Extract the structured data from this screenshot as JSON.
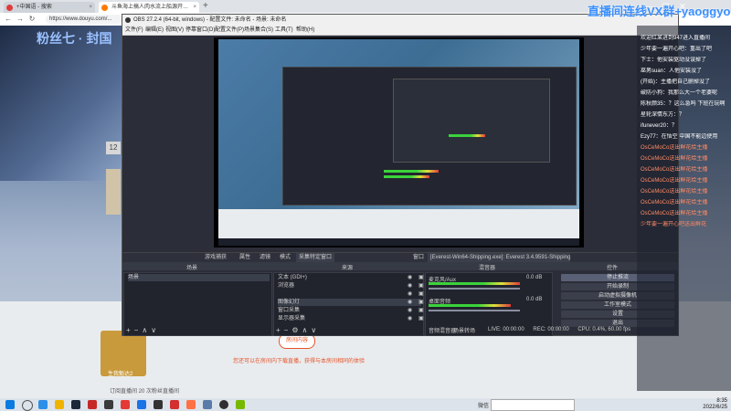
{
  "browser": {
    "tabs": [
      {
        "label": "+中国语 - 搜索"
      },
      {
        "label": "斗鱼海上搞人肉水流上船源开…"
      }
    ],
    "url": "https://www.douyu.com/..."
  },
  "stream": {
    "game_title": "粉丝七 · 封国",
    "room_button": "房间内容",
    "hint": "您还可以在房间内下载直播，获得与本房间相同的体验",
    "gift": "生我魁达2",
    "fav_text": "订阅直播间  20 次粉丝直播间"
  },
  "watermark": "直播间连线VX群+yaoggyo",
  "obs": {
    "title": "OBS 27.2.4 (64-bit, windows) - 配置文件: 未命名 - 场景: 未命名",
    "menu": [
      "文件(F)",
      "编辑(E)",
      "视图(V)",
      "停靠窗口(D)",
      "配置文件(P)",
      "场景集合(S)",
      "工具(T)",
      "帮助(H)"
    ],
    "toolbar": {
      "source_name": "游戏捕获",
      "properties": "属性",
      "filters": "滤镜",
      "mode_label": "模式",
      "mode_value": "采集特定窗口",
      "window_label": "窗口",
      "window_value": "[Everest-Win64-Shipping.exe]: Everest 3.4.9591-Shipping-Steam"
    },
    "docks": {
      "scenes_title": "场景",
      "scene_item": "场景",
      "sources_title": "来源",
      "sources": [
        "文本 (GDI+)",
        "浏览器",
        "",
        "图像幻灯",
        "窗口采集",
        "显示器采集"
      ],
      "mixer_title": "混音器",
      "mixer_tracks": [
        "桌面音频",
        "麦克风/Aux"
      ],
      "mixer_value": "0.0 dB",
      "controls_title": "控件",
      "controls": [
        "停止推流",
        "开始录制",
        "启动虚拟摄像机",
        "工作室模式",
        "设置",
        "退出"
      ]
    },
    "mixer_tabs": [
      "音频混音器",
      "场景转场"
    ],
    "status": {
      "live": "LIVE: 00:00:00",
      "rec": "REC: 00:00:00",
      "cpu": "CPU: 0.4%, 60.00 fps"
    }
  },
  "chat": [
    {
      "text": "欢迎红某进到947进入直播间",
      "color": "#ffffff"
    },
    {
      "text": "少年要一遍开心吧：重出了吧",
      "color": "#ffffff"
    },
    {
      "text": "下士：他安装驱动没误掉了",
      "color": "#ffffff"
    },
    {
      "text": "巫男suan：人他安装没了",
      "color": "#ffffff"
    },
    {
      "text": "(开始)：主播把自己删掉没了",
      "color": "#ffffff"
    },
    {
      "text": "破防小狗：我那么大一个老婆呢",
      "color": "#ffffff"
    },
    {
      "text": "陈秋颜35：？这么急吗 下班在玩啊",
      "color": "#ffffff"
    },
    {
      "text": "星轮深情东方：？",
      "color": "#ffffff"
    },
    {
      "text": "ifunever20：？",
      "color": "#ffffff"
    },
    {
      "text": "Ezy77：在悟空 中国不能边使用",
      "color": "#ffffff"
    },
    {
      "text": "OsCeMoCo送出鲜花给主播",
      "color": "#ff8a65"
    },
    {
      "text": "OsCeMoCo送出鲜花给主播",
      "color": "#ff8a65"
    },
    {
      "text": "OsCeMoCo送出鲜花给主播",
      "color": "#ff8a65"
    },
    {
      "text": "OsCeMoCo送出鲜花给主播",
      "color": "#ff8a65"
    },
    {
      "text": "OsCeMoCo送出鲜花给主播",
      "color": "#ff8a65"
    },
    {
      "text": "OsCeMoCo送出鲜花给主播",
      "color": "#ff8a65"
    },
    {
      "text": "OsCeMoCo送出鲜花给主播",
      "color": "#ff8a65"
    },
    {
      "text": "少年要一遍开心吧送出鲜花",
      "color": "#ff8a65"
    }
  ],
  "taskbar": {
    "search_label": "微信",
    "time": "8:35",
    "date": "2022/6/25"
  }
}
